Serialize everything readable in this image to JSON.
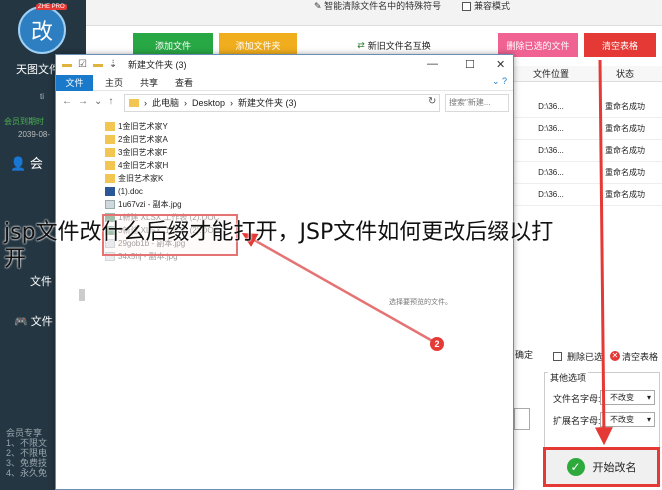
{
  "app": {
    "badge": "ZHE PRO",
    "logo_char": "改",
    "name": "天图文件",
    "side_tiny": "ti",
    "member_line": "会员到期时",
    "member_date": "2039-08-",
    "member_item": "会",
    "side_file": "文件",
    "side_file2": "文件",
    "member_notes": [
      "会员专享",
      "1、不限文",
      "2、不限电",
      "3、免费技",
      "4、永久免"
    ],
    "title": "智能清除文件名中的特殊符号",
    "compat_label": "兼容模式",
    "buttons": {
      "add_file": "添加文件",
      "add_folder": "添加文件夹",
      "clean": "新旧文件名互换",
      "delete_selected": "删除已选的文件",
      "clear_table": "清空表格"
    },
    "grid": {
      "headers": [
        "文件位置",
        "状态"
      ],
      "rows": [
        [
          "D:\\36...",
          "重命名成功"
        ],
        [
          "D:\\36...",
          "重命名成功"
        ],
        [
          "D:\\36...",
          "重命名成功"
        ],
        [
          "D:\\36...",
          "重命名成功"
        ],
        [
          "D:\\36...",
          "重命名成功"
        ]
      ]
    },
    "confirm_label": "确定",
    "delete_selected_label": "删除已选",
    "clear_label": "清空表格",
    "options": {
      "title": "其他选项",
      "file_case_label": "文件名字母:",
      "file_case_value": "不改变",
      "ext_case_label": "扩展名字母:",
      "ext_case_value": "不改变"
    },
    "start_label": "开始改名",
    "colors": {
      "add_file": "#28a745",
      "add_folder": "#f0ad1e",
      "delete_selected": "#f06292",
      "clear": "#e53935",
      "sidebar": "#243642"
    }
  },
  "explorer": {
    "title": "新建文件夹 (3)",
    "tabs": {
      "file": "文件",
      "home": "主页",
      "share": "共享",
      "view": "查看"
    },
    "address": [
      "此电脑",
      "Desktop",
      "新建文件夹 (3)"
    ],
    "search_placeholder": "搜索\"新建...",
    "files": [
      {
        "name": "1金旧艺术家Y",
        "type": "folder"
      },
      {
        "name": "2金旧艺术家A",
        "type": "folder"
      },
      {
        "name": "3金旧艺术家F",
        "type": "folder"
      },
      {
        "name": "4金旧艺术家H",
        "type": "folder"
      },
      {
        "name": "金旧艺术家K",
        "type": "folder"
      },
      {
        "name": "(1).doc",
        "type": "doc"
      },
      {
        "name": "1u67vzi - 副本.jpg",
        "type": "jpg"
      },
      {
        "name": "1新建 XLSX 工作表 (2).DOC",
        "type": "xls",
        "faded": true
      },
      {
        "name": "3新建 XLSX 工作表 (2).DOC",
        "type": "xls",
        "faded": true
      },
      {
        "name": "29gob1b - 副本.jpg",
        "type": "jpg",
        "faded": true
      },
      {
        "name": "34x5hj - 副本.jpg",
        "type": "jpg",
        "faded": true
      }
    ],
    "preview_text": "选择要预览的文件。",
    "callout": "2"
  },
  "watermark": {
    "line1": "jsp文件改什么后缀才能打开，JSP文件如何更改后缀以打",
    "line2": "开"
  }
}
